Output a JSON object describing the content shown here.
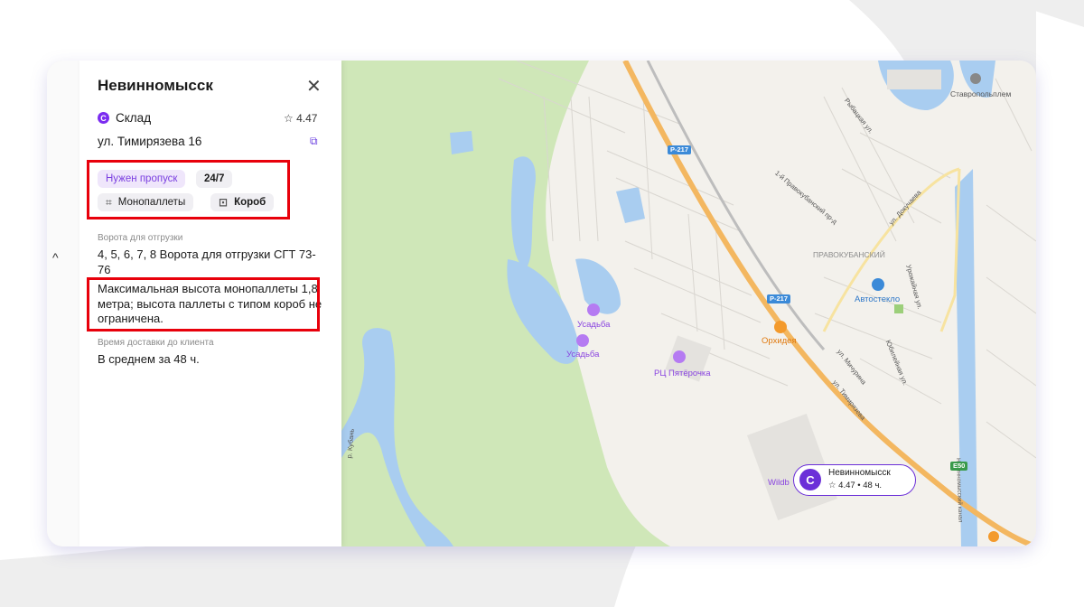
{
  "panel": {
    "title": "Невинномысск",
    "type_icon_letter": "С",
    "type": "Склад",
    "rating": "☆ 4.47",
    "address": "ул. Тимирязева 16",
    "tags": {
      "pass": "Нужен пропуск",
      "hours": "24/7",
      "monopallets": "Монопаллеты",
      "box": "Короб"
    },
    "gates_label": "Ворота для отгрузки",
    "gates_value": "4, 5, 6, 7, 8 Ворота для отгрузки СГТ 73-76",
    "max_height_text": "Максимальная высота монопаллеты 1,8 метра; высота паллеты с типом короб не ограничена.",
    "delivery_label": "Время доставки до клиента",
    "delivery_value": "В среднем за 48 ч."
  },
  "map": {
    "places": {
      "usadba_1": "Усадьба",
      "usadba_2": "Усадьба",
      "rc": "РЦ Пятёрочка",
      "orhideya": "Орхидея",
      "avtosteklo": "Автостекло",
      "district": "ПРАВОКУБАНСКИЙ",
      "stavropolplem": "Ставропольплем",
      "wildberries_partial": "Wildb"
    },
    "streets": {
      "rybackaya": "Рыбацкая ул.",
      "pravokuban": "1-й Правокубанский пр-д",
      "dokuchaeva": "ул. Докучаева",
      "urozhaynaya": "Урожайная ул.",
      "yubileynaya": "Юбилейная ул.",
      "michurina": "ул. Мичурина",
      "timiryazeva": "ул. Тимирязева",
      "river": "р. Кубань",
      "canal": "Невинномысский канал"
    },
    "highway_1": "Р-217",
    "highway_2": "Р-217",
    "highway_3": "Е50",
    "warehouse_marker": {
      "letter": "С",
      "name": "Невинномысск",
      "meta": "☆ 4.47 • 48 ч."
    },
    "colors": {
      "water": "#a9cdf0",
      "park": "#cfe7b8",
      "highway": "#f3b760",
      "accent": "#6b2fd8",
      "highlight": "#e8000b"
    }
  }
}
